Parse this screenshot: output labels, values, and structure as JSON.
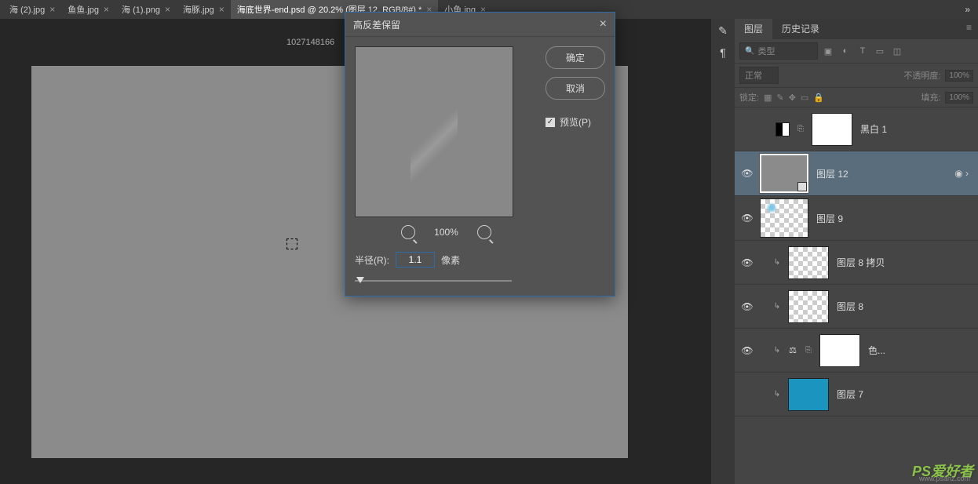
{
  "tabs": [
    {
      "label": "海 (2).jpg"
    },
    {
      "label": "鱼鱼.jpg"
    },
    {
      "label": "海 (1).png"
    },
    {
      "label": "海豚.jpg"
    },
    {
      "label": "海底世界-end.psd @ 20.2% (图层 12, RGB/8#) *",
      "active": true
    },
    {
      "label": "小鱼.jpg"
    }
  ],
  "canvas_label": "1027148166",
  "dialog": {
    "title": "高反差保留",
    "ok": "确定",
    "cancel": "取消",
    "preview_label": "预览(P)",
    "zoom": "100%",
    "radius_label": "半径(R):",
    "radius_value": "1.1",
    "radius_unit": "像素"
  },
  "panel": {
    "tab_layers": "图层",
    "tab_history": "历史记录",
    "search_placeholder": "类型",
    "blend_mode": "正常",
    "opacity_label": "不透明度:",
    "opacity_value": "100%",
    "lock_label": "锁定:",
    "fill_label": "填充:",
    "fill_value": "100%"
  },
  "layers": {
    "l0": "黑白 1",
    "l1": "图层 12",
    "l2": "图层 9",
    "l3": "图层 8 拷贝",
    "l4": "图层 8",
    "l5": "色...",
    "l6": "图层 7"
  },
  "watermark": "PS爱好者",
  "watermark_url": "www.psahz.com"
}
